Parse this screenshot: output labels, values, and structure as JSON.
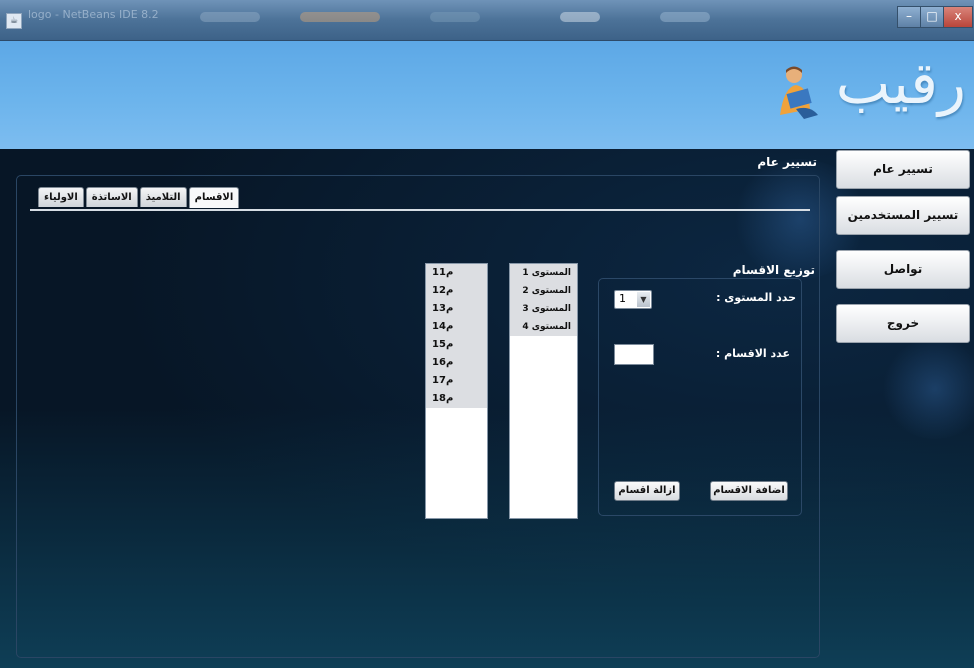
{
  "window": {
    "title": "logo - NetBeans IDE 8.2",
    "controls": {
      "minimize": "–",
      "maximize": "□",
      "close": "x"
    }
  },
  "banner": {
    "logo_text": "رقيب"
  },
  "sidebar": {
    "buttons": [
      {
        "label": "تسيير عام"
      },
      {
        "label": "تسيير المستخدمين"
      },
      {
        "label": "تواصل"
      },
      {
        "label": "خروج"
      }
    ]
  },
  "main": {
    "section_title": "تسيير عام",
    "tabs": [
      {
        "label": "الاقسام",
        "active": true
      },
      {
        "label": "التلاميذ",
        "active": false
      },
      {
        "label": "الاساتذة",
        "active": false
      },
      {
        "label": "الاولياء",
        "active": false
      }
    ],
    "levels_list": [
      "المستوى 1",
      "المستوى 2",
      "المستوى 3",
      "المستوى 4"
    ],
    "classes_list": [
      "1م1",
      "1م2",
      "1م3",
      "1م4",
      "1م5",
      "1م6",
      "1م7",
      "1م8"
    ],
    "distribution": {
      "title": "توزيع الاقسام",
      "level_label": "حدد المستوى :",
      "level_value": "1",
      "count_label": "عدد الاقسام :",
      "count_value": "",
      "add_button": "اضافة الاقسام",
      "remove_button": "ازالة اقسام"
    }
  },
  "colors": {
    "banner": "#6cb4ec",
    "background": "#071626",
    "list_item_bg": "#dcdee2"
  }
}
